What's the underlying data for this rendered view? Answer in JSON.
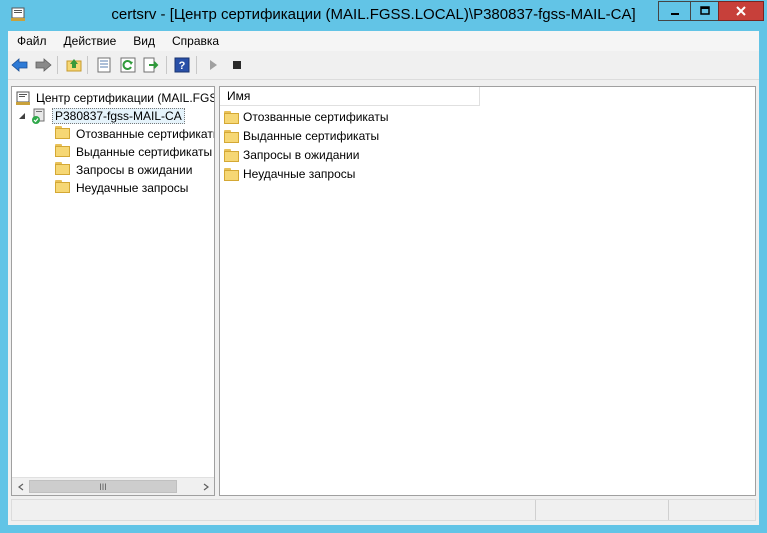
{
  "window": {
    "title": "certsrv - [Центр сертификации (MAIL.FGSS.LOCAL)\\P380837-fgss-MAIL-CA]",
    "controls": {
      "minimize": "minimize-icon",
      "maximize": "maximize-icon",
      "close": "close-icon"
    }
  },
  "menu": {
    "items": [
      {
        "label": "Файл"
      },
      {
        "label": "Действие"
      },
      {
        "label": "Вид"
      },
      {
        "label": "Справка"
      }
    ]
  },
  "toolbar": {
    "buttons": [
      "back-arrow-icon",
      "forward-arrow-icon",
      "up-folder-icon",
      "properties-icon",
      "refresh-icon",
      "export-list-icon",
      "help-icon",
      "start-service-icon",
      "stop-service-icon"
    ]
  },
  "tree": {
    "root_label": "Центр сертификации (MAIL.FGS",
    "ca_label": "P380837-fgss-MAIL-CA",
    "children": [
      {
        "label": "Отозванные сертификаты"
      },
      {
        "label": "Выданные сертификаты"
      },
      {
        "label": "Запросы в ожидании"
      },
      {
        "label": "Неудачные запросы"
      }
    ],
    "scroll_thumb": "III"
  },
  "list": {
    "column_name": "Имя",
    "items": [
      {
        "label": "Отозванные сертификаты"
      },
      {
        "label": "Выданные сертификаты"
      },
      {
        "label": "Запросы в ожидании"
      },
      {
        "label": "Неудачные запросы"
      }
    ]
  },
  "colors": {
    "window_frame": "#62c4e6",
    "close_button": "#c7403a",
    "folder": "#f6d774",
    "selection": "#e5f3fb"
  }
}
